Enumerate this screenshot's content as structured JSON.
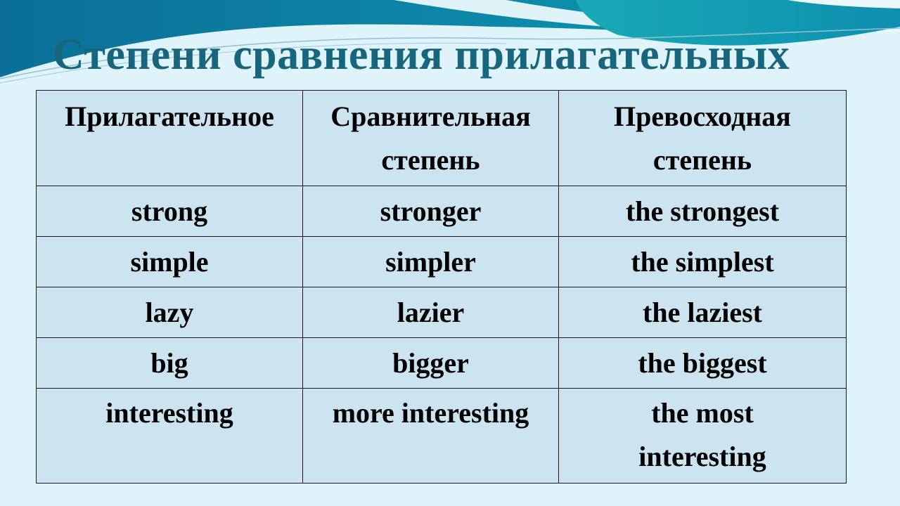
{
  "slide": {
    "title": "Степени сравнения прилагательных",
    "colors": {
      "title": "#17667e",
      "table_fill": "#cce4f0",
      "background": "#dff3fa",
      "wave_dark": "#0a7ea3",
      "wave_teal": "#1aa6b0"
    }
  },
  "table": {
    "headers": [
      {
        "line1": "Прилагательное",
        "line2": ""
      },
      {
        "line1": "Сравнительная",
        "line2": "степень"
      },
      {
        "line1": "Превосходная",
        "line2": "степень"
      }
    ],
    "rows": [
      [
        "strong",
        "stronger",
        "the strongest"
      ],
      [
        "simple",
        "simpler",
        "the simplest"
      ],
      [
        "lazy",
        "lazier",
        "the laziest"
      ],
      [
        "big",
        "bigger",
        "the biggest"
      ],
      [
        "interesting",
        "more interesting",
        "the most interesting"
      ]
    ],
    "last_row_superlative_lines": [
      "the most",
      "interesting"
    ]
  }
}
